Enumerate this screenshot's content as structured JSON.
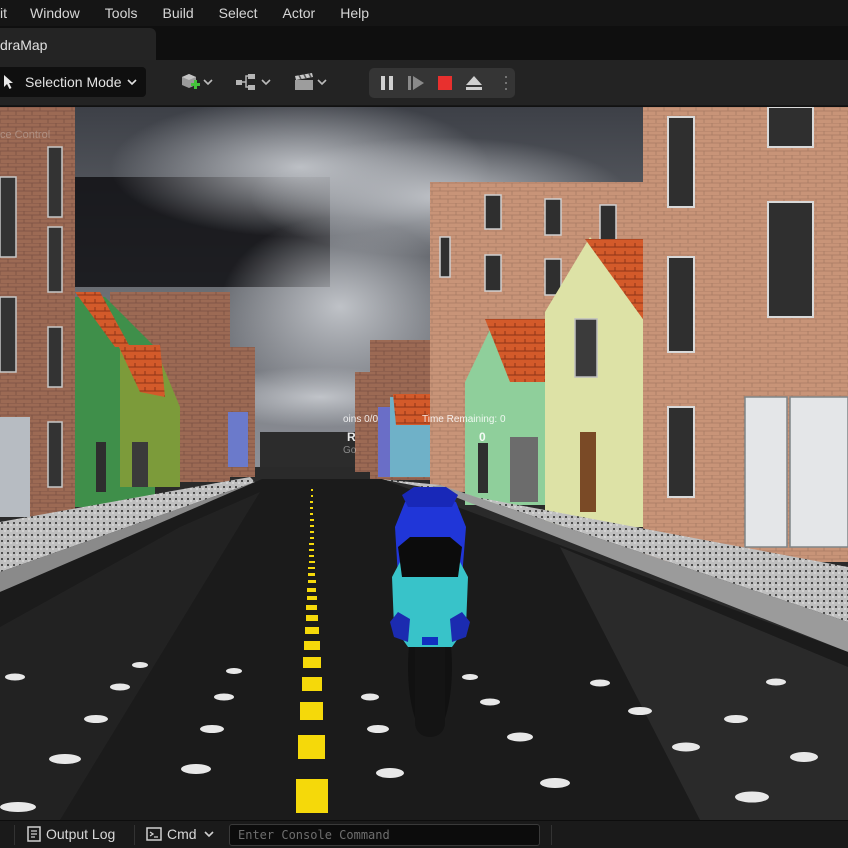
{
  "menu": {
    "items": [
      "it",
      "Window",
      "Tools",
      "Build",
      "Select",
      "Actor",
      "Help"
    ]
  },
  "tab": {
    "label": "draMap"
  },
  "toolbar": {
    "selection_mode": "Selection Mode",
    "icons": [
      "add-actor-icon",
      "blueprint-icon",
      "cinematics-icon"
    ],
    "play_controls": [
      "pause-icon",
      "step-frame-icon",
      "stop-icon",
      "eject-icon",
      "more-options-icon"
    ]
  },
  "viewport": {
    "hud_label": "ce Control",
    "hud_coins_label": "oins 0/0",
    "hud_time_label": "Time Remaining: 0",
    "hud_left_value": "R",
    "hud_right_value": "0",
    "hud_left_sub": "Go",
    "colors": {
      "stop": "#e8302e",
      "road_line": "#f5d90a",
      "sky": "#5a5d63"
    }
  },
  "bottom": {
    "output_log": "Output Log",
    "cmd": "Cmd",
    "console_placeholder": "Enter Console Command"
  }
}
